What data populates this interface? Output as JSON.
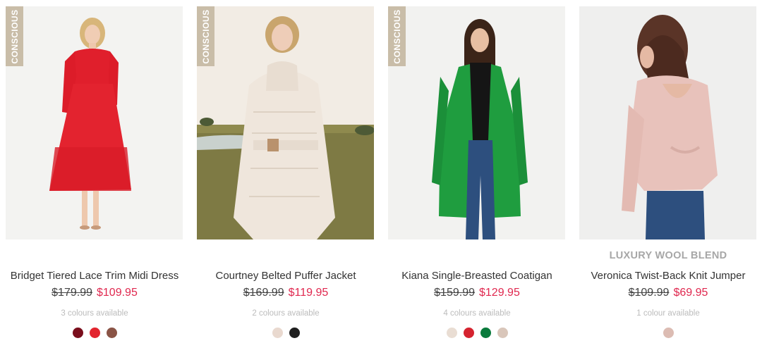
{
  "products": [
    {
      "badge": "CONSCIOUS",
      "promo": "",
      "name": "Bridget Tiered Lace Trim Midi Dress",
      "was_price": "$179.99",
      "now_price": "$109.95",
      "colours_text": "3 colours available",
      "swatches": [
        "#7a0e1c",
        "#e2242e",
        "#8a5446"
      ],
      "image_bg": "#f3f3f1",
      "garment_color": "#e01f2c"
    },
    {
      "badge": "CONSCIOUS",
      "promo": "",
      "name": "Courtney Belted Puffer Jacket",
      "was_price": "$169.99",
      "now_price": "$119.95",
      "colours_text": "2 colours available",
      "swatches": [
        "#e9d9cf",
        "#1f1f1f"
      ],
      "image_bg": "#efe8df",
      "garment_color": "#efe6dc"
    },
    {
      "badge": "CONSCIOUS",
      "promo": "",
      "name": "Kiana Single-Breasted Coatigan",
      "was_price": "$159.99",
      "now_price": "$129.95",
      "colours_text": "4 colours available",
      "swatches": [
        "#e9ddd3",
        "#d5232f",
        "#0a7a3c",
        "#d9c6ba"
      ],
      "image_bg": "#f2f2f0",
      "garment_color": "#1f9d3f"
    },
    {
      "badge": "",
      "promo": "LUXURY WOOL BLEND",
      "name": "Veronica Twist-Back Knit Jumper",
      "was_price": "$109.99",
      "now_price": "$69.95",
      "colours_text": "1 colour available",
      "swatches": [
        "#dcbcb3"
      ],
      "image_bg": "#efefee",
      "garment_color": "#e8c2bb"
    }
  ]
}
